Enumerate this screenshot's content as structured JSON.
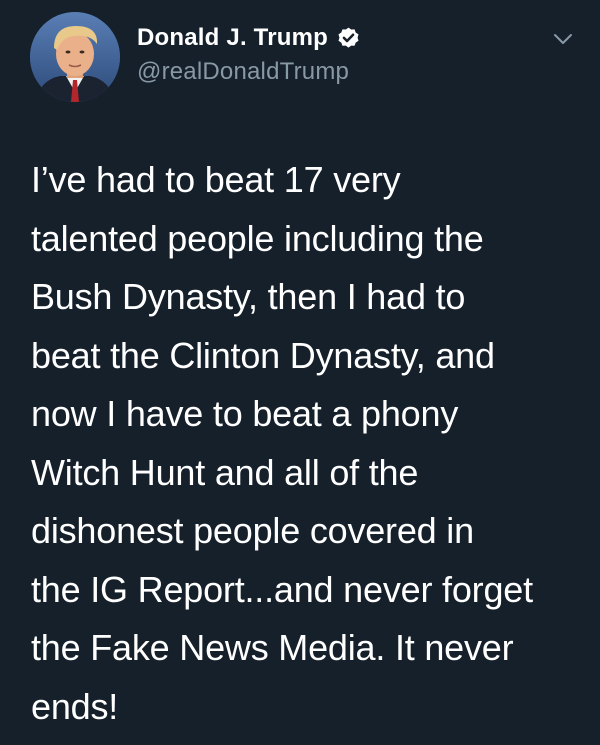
{
  "author": {
    "display_name": "Donald J. Trump",
    "handle": "@realDonaldTrump",
    "verified": true,
    "avatar_icon": "profile-photo"
  },
  "menu": {
    "icon": "chevron-down-icon"
  },
  "tweet": {
    "lines": [
      "I’ve had to beat 17 very",
      "talented people including the",
      "Bush Dynasty, then I had to",
      "beat the Clinton Dynasty, and",
      "now I have to beat a phony",
      "Witch Hunt and all of the",
      "dishonest people covered in",
      "the IG Report...and never forget",
      "the Fake News Media. It never",
      "ends!"
    ]
  },
  "colors": {
    "background": "#15202b",
    "text": "#ffffff",
    "handle": "#8899a6",
    "chevron": "#8899a6",
    "verified_badge": "#ffffff"
  }
}
